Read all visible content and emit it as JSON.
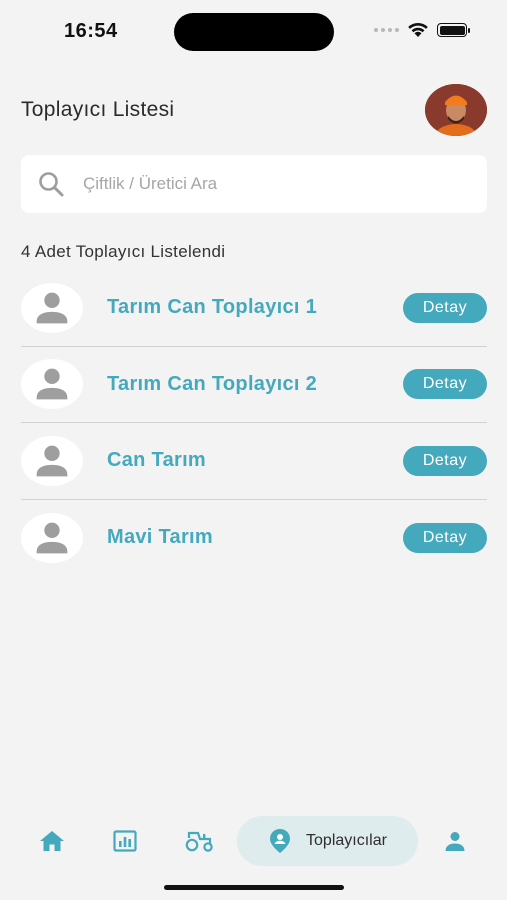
{
  "status_bar": {
    "time": "16:54"
  },
  "header": {
    "title": "Toplayıcı Listesi"
  },
  "search": {
    "placeholder": "Çiftlik / Üretici Ara",
    "value": ""
  },
  "list_summary": "4 Adet Toplayıcı Listelendi",
  "items": [
    {
      "name": "Tarım Can Toplayıcı 1",
      "button": "Detay"
    },
    {
      "name": "Tarım Can Toplayıcı 2",
      "button": "Detay"
    },
    {
      "name": "Can Tarım",
      "button": "Detay"
    },
    {
      "name": "Mavi Tarım",
      "button": "Detay"
    }
  ],
  "nav": {
    "items": [
      {
        "icon": "home-icon",
        "label": ""
      },
      {
        "icon": "chart-icon",
        "label": ""
      },
      {
        "icon": "tractor-icon",
        "label": ""
      },
      {
        "icon": "collector-pin-icon",
        "label": "Toplayıcılar",
        "active": true
      },
      {
        "icon": "profile-icon",
        "label": ""
      }
    ]
  },
  "colors": {
    "accent": "#45a9bd",
    "background": "#f3f3f3",
    "active_tab_bg": "#dfecee"
  }
}
